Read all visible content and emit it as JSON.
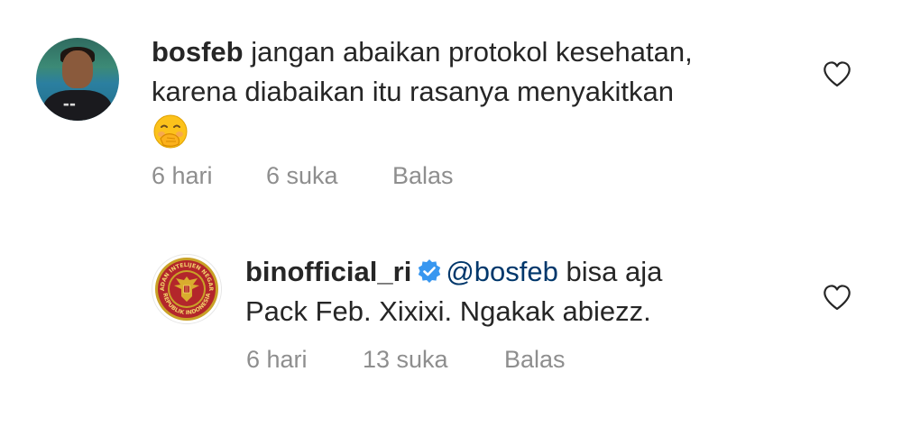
{
  "comments": [
    {
      "username": "bosfeb",
      "text_line1": "jangan abaikan protokol kesehatan,",
      "text_line2": "karena diabaikan itu rasanya menyakitkan",
      "emoji": "hand-over-mouth-emoji",
      "time": "6 hari",
      "likes": "6 suka",
      "reply": "Balas",
      "avatar": "user-photo-avatar"
    },
    {
      "username": "binofficial_ri",
      "verified": true,
      "mention": "@bosfeb",
      "text_line1_rest": "bisa aja",
      "text_line2": "Pack Feb. Xixixi. Ngakak abiezz.",
      "time": "6 hari",
      "likes": "13 suka",
      "reply": "Balas",
      "avatar": "bin-emblem-avatar",
      "avatar_ring_text_top": "BADAN INTELIJEN NEGARA",
      "avatar_ring_text_bottom": "REPUBLIK INDONESIA"
    }
  ],
  "icons": {
    "like": "heart-outline-icon",
    "verified": "verified-badge-icon"
  },
  "colors": {
    "text": "#262626",
    "meta": "#8e8e8e",
    "mention": "#00376b",
    "verified": "#3897f0",
    "emblem_red": "#b3262b",
    "emblem_gold": "#c9a227"
  }
}
